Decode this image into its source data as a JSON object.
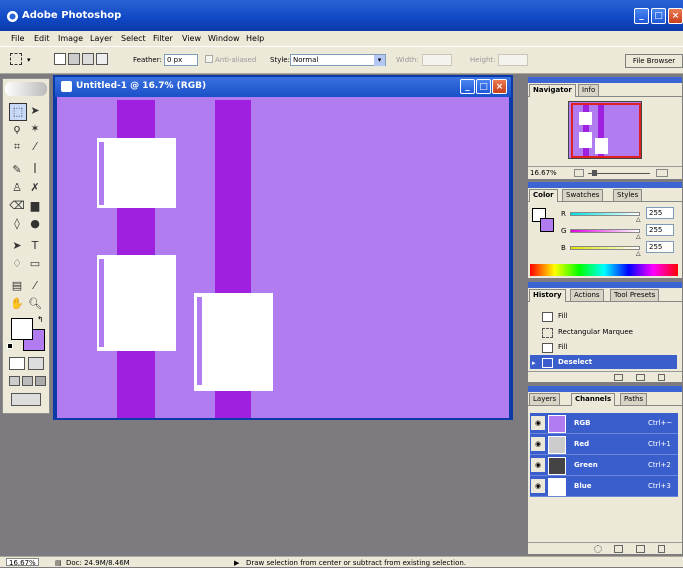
{
  "app": {
    "title": "Adobe Photoshop"
  },
  "menu": [
    "File",
    "Edit",
    "Image",
    "Layer",
    "Select",
    "Filter",
    "View",
    "Window",
    "Help"
  ],
  "options": {
    "feather_label": "Feather:",
    "feather_value": "0 px",
    "antialiased_label": "Anti-aliased",
    "style_label": "Style:",
    "style_value": "Normal",
    "width_label": "Width:",
    "height_label": "Height:",
    "file_browser": "File Browser"
  },
  "document": {
    "title": "Untitled-1 @ 16.7% (RGB)",
    "canvas_color": "#b17cf0",
    "stripe_color": "#a020e0"
  },
  "navigator": {
    "tabs": [
      "Navigator",
      "Info"
    ],
    "zoom": "16.67%"
  },
  "color_panel": {
    "tabs": [
      "Color",
      "Swatches",
      "Styles"
    ],
    "channels": [
      {
        "label": "R",
        "value": "255"
      },
      {
        "label": "G",
        "value": "255"
      },
      {
        "label": "B",
        "value": "255"
      }
    ]
  },
  "history": {
    "tabs": [
      "History",
      "Actions",
      "Tool Presets"
    ],
    "items": [
      "Fill",
      "Rectangular Marquee",
      "Fill",
      "Deselect"
    ]
  },
  "layers_panel": {
    "tabs": [
      "Layers",
      "Channels",
      "Paths"
    ],
    "channels": [
      {
        "name": "RGB",
        "shortcut": "Ctrl+~"
      },
      {
        "name": "Red",
        "shortcut": "Ctrl+1"
      },
      {
        "name": "Green",
        "shortcut": "Ctrl+2"
      },
      {
        "name": "Blue",
        "shortcut": "Ctrl+3"
      }
    ]
  },
  "status": {
    "zoom": "16.67%",
    "doc": "Doc: 24.9M/8.46M",
    "hint": "Draw selection from center or subtract from existing selection."
  }
}
